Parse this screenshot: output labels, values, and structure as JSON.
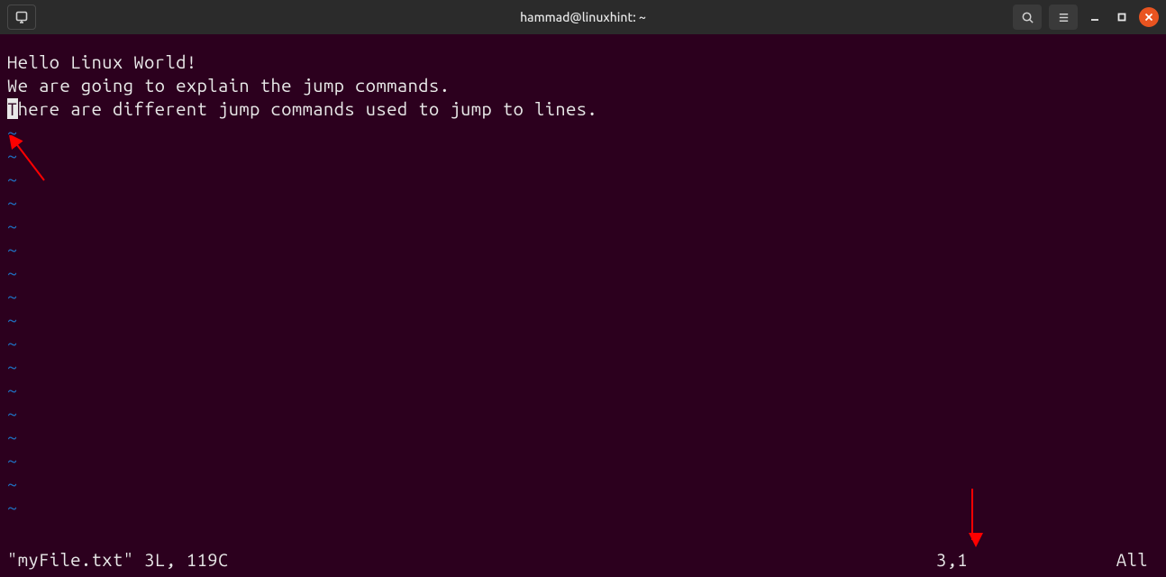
{
  "titlebar": {
    "title": "hammad@linuxhint: ~"
  },
  "editor": {
    "line1": "Hello Linux World!",
    "line2": "We are going to explain the jump commands.",
    "line3_cursor_char": "T",
    "line3_rest": "here are different jump commands used to jump to lines.",
    "tilde": "~"
  },
  "status": {
    "file_info": "\"myFile.txt\" 3L, 119C",
    "cursor_pos": "3,1",
    "scroll": "All"
  },
  "colors": {
    "background": "#2c001e",
    "foreground": "#e8e8e8",
    "tilde": "#1f6fbf",
    "close_button": "#e95420",
    "arrow": "#ff0000"
  }
}
